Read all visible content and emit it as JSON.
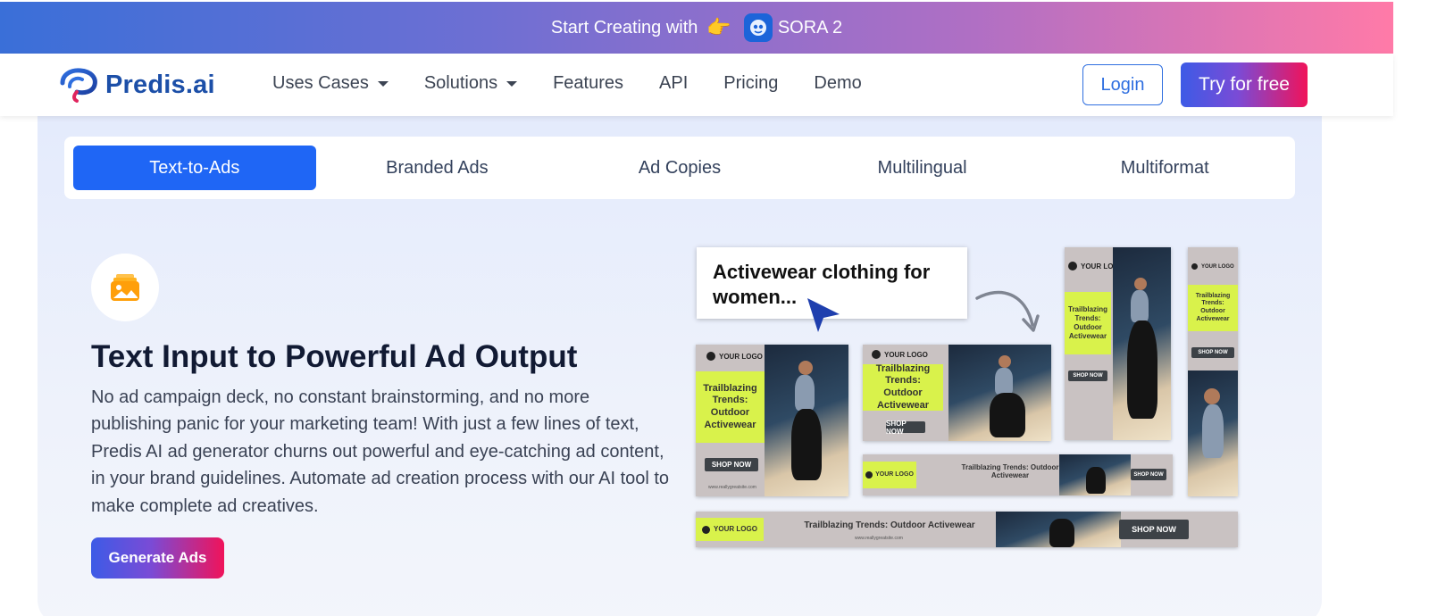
{
  "banner": {
    "text": "Start Creating with",
    "hand": "👉",
    "product": "SORA 2"
  },
  "nav": {
    "brand": "Predis.ai",
    "items": [
      {
        "label": "Uses Cases",
        "dropdown": true
      },
      {
        "label": "Solutions",
        "dropdown": true
      },
      {
        "label": "Features",
        "dropdown": false
      },
      {
        "label": "API",
        "dropdown": false
      },
      {
        "label": "Pricing",
        "dropdown": false
      },
      {
        "label": "Demo",
        "dropdown": false
      }
    ],
    "login": "Login",
    "try": "Try for free"
  },
  "tabs": [
    {
      "label": "Text-to-Ads",
      "active": true
    },
    {
      "label": "Branded Ads",
      "active": false
    },
    {
      "label": "Ad Copies",
      "active": false
    },
    {
      "label": "Multilingual",
      "active": false
    },
    {
      "label": "Multiformat",
      "active": false
    }
  ],
  "feature": {
    "icon": "image-stack-icon",
    "title": "Text Input to Powerful Ad Output",
    "description": "No ad campaign deck, no constant brainstorming, and no more publishing panic for your marketing team! With just a few lines of text, Predis AI ad generator churns out powerful and eye-catching ad content, in your brand guidelines. Automate ad creation process with our AI tool to make complete ad creatives.",
    "cta": "Generate Ads"
  },
  "collage": {
    "prompt": "Activewear clothing for women...",
    "logo_text": "YOUR LOGO",
    "headline": "Trailblazing Trends: Outdoor Activewear",
    "shop": "SHOP NOW",
    "site": "www.reallygreatsite.com"
  },
  "colors": {
    "primary": "#1f66f5",
    "brand": "#1c4fa8",
    "gradient_start": "#3d5be6",
    "gradient_end": "#f0135a",
    "ad_accent": "#d9f24b"
  }
}
